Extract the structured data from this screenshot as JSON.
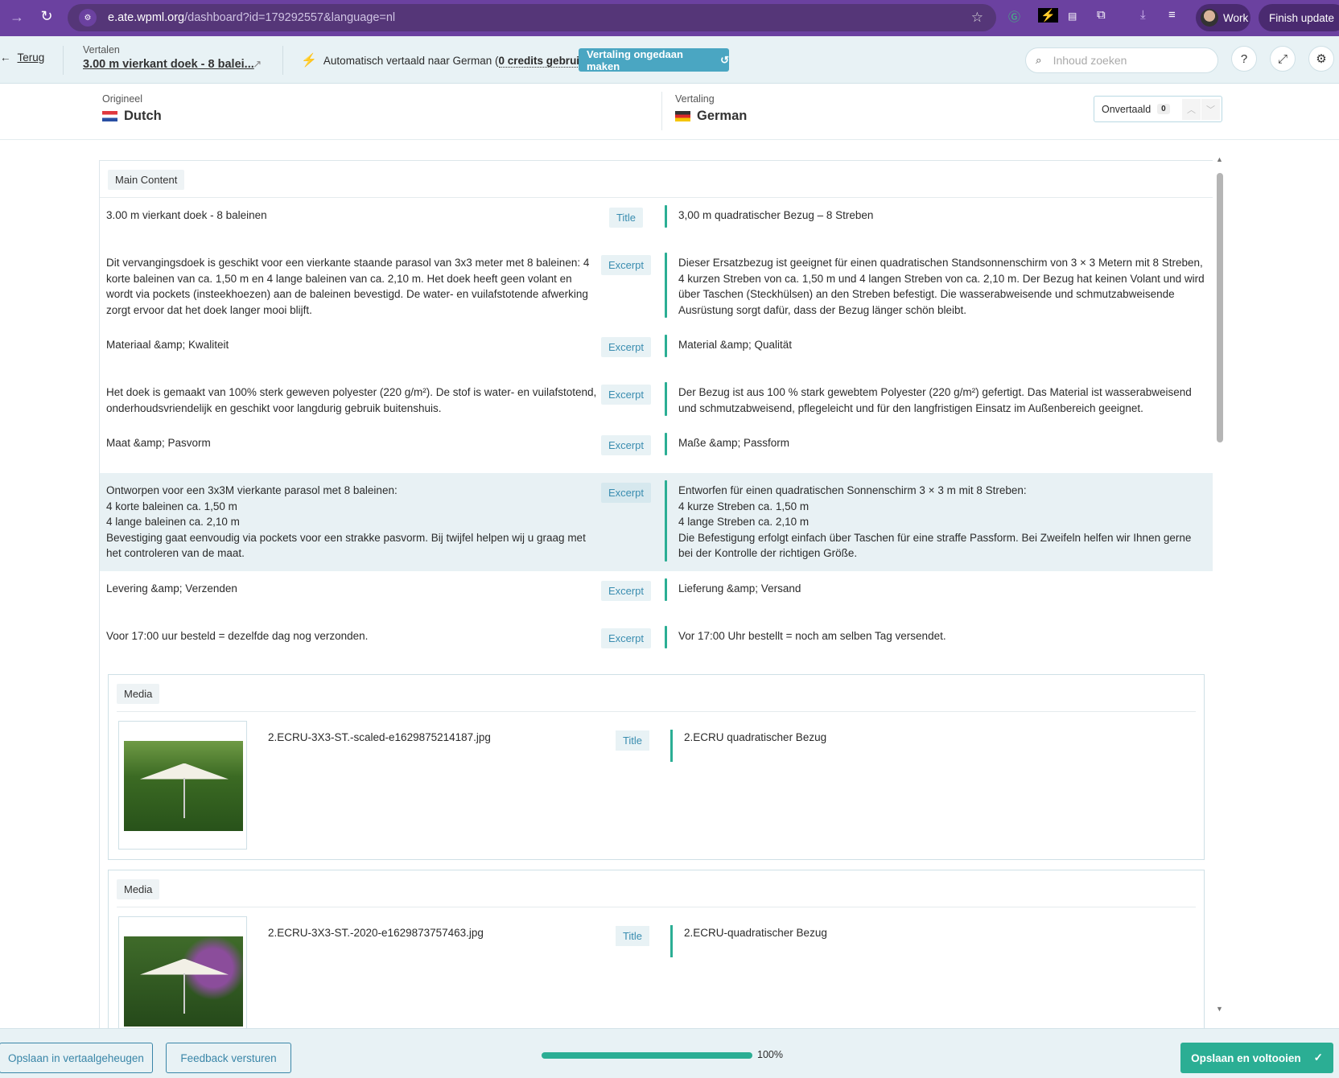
{
  "browser": {
    "url_host": "e.ate.wpml.org",
    "url_path": "/dashboard?id=179292557&language=nl",
    "profile": "Work",
    "finish_update": "Finish update"
  },
  "header": {
    "back": "Terug",
    "translate_label": "Vertalen",
    "doc_title": "3.00 m vierkant doek - 8 balei...",
    "auto_prefix": "Automatisch vertaald naar German (",
    "credits": "0 credits gebruikt",
    "auto_suffix": ")",
    "undo": "Vertaling ongedaan maken",
    "search_placeholder": "Inhoud zoeken"
  },
  "languages": {
    "source_label": "Origineel",
    "source": "Dutch",
    "target_label": "Vertaling",
    "target": "German",
    "untranslated_label": "Onvertaald",
    "untranslated_count": "0"
  },
  "main_section": "Main Content",
  "rows": [
    {
      "src": "3.00 m vierkant doek - 8 baleinen",
      "type": "Title",
      "tgt": "3,00 m quadratischer Bezug – 8 Streben"
    },
    {
      "src": "Dit vervangingsdoek is geschikt voor een vierkante staande parasol van 3x3 meter met 8 baleinen: 4 korte baleinen van ca. 1,50 m en 4 lange baleinen van ca. 2,10 m. Het doek heeft geen volant en wordt via pockets (insteekhoezen) aan de baleinen bevestigd. De water- en vuilafstotende afwerking zorgt ervoor dat het doek langer mooi blijft.",
      "type": "Excerpt",
      "tgt": "Dieser Ersatzbezug ist geeignet für einen quadratischen Standsonnenschirm von 3 × 3 Metern mit 8 Streben, 4 kurzen Streben von ca. 1,50 m und 4 langen Streben von ca. 2,10 m. Der Bezug hat keinen Volant und wird über Taschen (Steckhülsen) an den Streben befestigt. Die wasserabweisende und schmutzabweisende Ausrüstung sorgt dafür, dass der Bezug länger schön bleibt."
    },
    {
      "src": "Materiaal &amp; Kwaliteit",
      "type": "Excerpt",
      "tgt": "Material &amp; Qualität"
    },
    {
      "src": "Het doek is gemaakt van 100% sterk geweven polyester (220 g/m²). De stof is water- en vuilafstotend, onderhoudsvriendelijk en geschikt voor langdurig gebruik buitenshuis.",
      "type": "Excerpt",
      "tgt": "Der Bezug ist aus 100 % stark gewebtem Polyester (220 g/m²) gefertigt. Das Material ist wasserabweisend und schmutzabweisend, pflegeleicht und für den langfristigen Einsatz im Außenbereich geeignet."
    },
    {
      "src": "Maat &amp; Pasvorm",
      "type": "Excerpt",
      "tgt": "Maße &amp; Passform"
    },
    {
      "src": "Ontworpen voor een 3x3M vierkante parasol met 8 baleinen:\n4 korte baleinen ca. 1,50 m\n4 lange baleinen ca. 2,10 m\nBevestiging gaat eenvoudig via pockets voor een strakke pasvorm. Bij twijfel helpen wij u graag met het controleren van de maat.",
      "type": "Excerpt",
      "tgt": "Entworfen für einen quadratischen Sonnenschirm 3 × 3 m mit 8 Streben:\n4 kurze Streben ca. 1,50 m\n4 lange Streben ca. 2,10 m\nDie Befestigung erfolgt einfach über Taschen für eine straffe Passform. Bei Zweifeln helfen wir Ihnen gerne bei der Kontrolle der richtigen Größe."
    },
    {
      "src": "Levering &amp; Verzenden",
      "type": "Excerpt",
      "tgt": "Lieferung &amp; Versand"
    },
    {
      "src": "Voor 17:00 uur besteld = dezelfde dag nog verzonden.",
      "type": "Excerpt",
      "tgt": "Vor 17:00 Uhr bestellt = noch am selben Tag versendet."
    }
  ],
  "media": [
    {
      "label": "Media",
      "file": "2.ECRU-3X3-ST.-scaled-e1629875214187.jpg",
      "type": "Title",
      "tgt": "2.ECRU quadratischer Bezug"
    },
    {
      "label": "Media",
      "file": "2.ECRU-3X3-ST.-2020-e1629873757463.jpg",
      "type": "Title",
      "tgt": "2.ECRU-quadratischer Bezug"
    }
  ],
  "footer": {
    "save_memory": "Opslaan in vertaalgeheugen",
    "feedback": "Feedback versturen",
    "progress_percent": 100,
    "progress_label": "100%",
    "save_complete": "Opslaan en voltooien"
  },
  "colors": {
    "accent": "#2bae94",
    "browser": "#6b41a0",
    "header_bg": "#e8f2f5",
    "undo_button": "#4aa6c2"
  }
}
